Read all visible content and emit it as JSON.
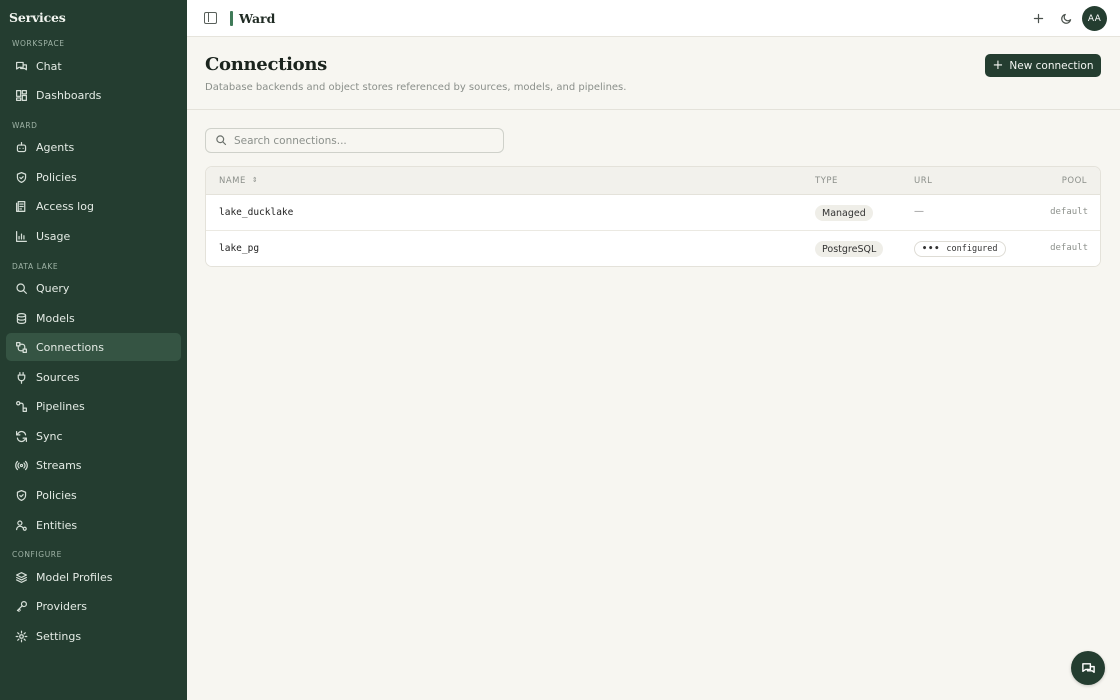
{
  "sidebar": {
    "brand": "Services",
    "sections": [
      "WORKSPACE",
      "WARD",
      "DATA LAKE",
      "CONFIGURE"
    ],
    "items": [
      {
        "label": "Chat",
        "icon": "chat-icon"
      },
      {
        "label": "Dashboards",
        "icon": "dashboard-icon"
      },
      {
        "label": "Agents",
        "icon": "robot-icon"
      },
      {
        "label": "Policies",
        "icon": "shield-icon"
      },
      {
        "label": "Access log",
        "icon": "log-icon"
      },
      {
        "label": "Usage",
        "icon": "bar-chart-icon"
      },
      {
        "label": "Query",
        "icon": "search-icon"
      },
      {
        "label": "Models",
        "icon": "database-icon"
      },
      {
        "label": "Connections",
        "icon": "connections-icon",
        "active": true
      },
      {
        "label": "Sources",
        "icon": "plug-icon"
      },
      {
        "label": "Pipelines",
        "icon": "pipeline-icon"
      },
      {
        "label": "Sync",
        "icon": "refresh-icon"
      },
      {
        "label": "Streams",
        "icon": "broadcast-icon"
      },
      {
        "label": "Policies",
        "icon": "shield-icon"
      },
      {
        "label": "Entities",
        "icon": "user-gear-icon"
      },
      {
        "label": "Model Profiles",
        "icon": "layers-icon"
      },
      {
        "label": "Providers",
        "icon": "key-icon"
      },
      {
        "label": "Settings",
        "icon": "gear-icon"
      }
    ]
  },
  "topbar": {
    "title": "Ward",
    "avatar_initials": "AA"
  },
  "header": {
    "title": "Connections",
    "subtitle": "Database backends and object stores referenced by sources, models, and pipelines.",
    "new_button_label": "New connection"
  },
  "search": {
    "placeholder": "Search connections...",
    "value": ""
  },
  "table": {
    "columns": [
      "NAME",
      "TYPE",
      "URL",
      "POOL"
    ],
    "rows": [
      {
        "name": "lake_ducklake",
        "type": "Managed",
        "url": "—",
        "pool": "default"
      },
      {
        "name": "lake_pg",
        "type": "PostgreSQL",
        "url": "configured",
        "pool": "default"
      }
    ]
  },
  "colors": {
    "sidebar_bg": "#243d30",
    "active_bg": "#355443",
    "accent": "#3f7a58",
    "page_bg": "#f7f6f1"
  }
}
